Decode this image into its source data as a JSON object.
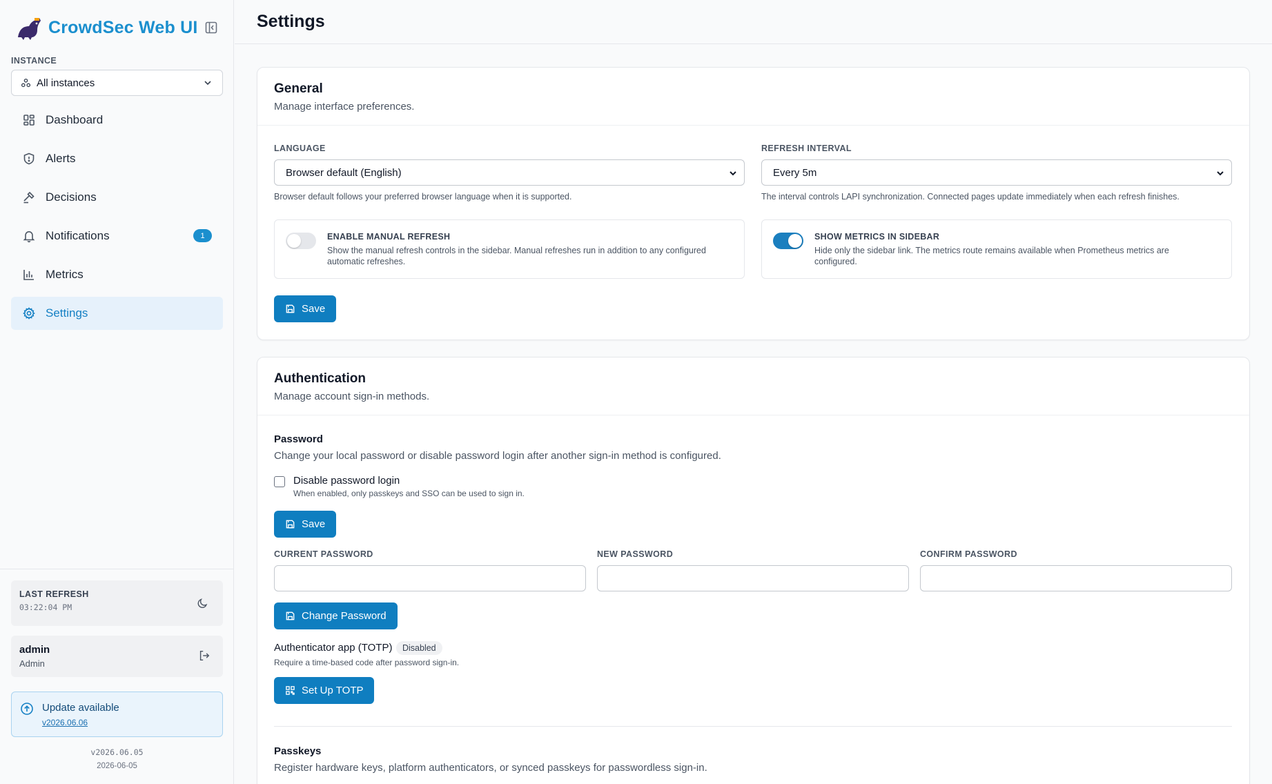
{
  "brand": {
    "title": "CrowdSec Web UI"
  },
  "instance": {
    "label": "INSTANCE",
    "selected": "All instances"
  },
  "nav": {
    "items": [
      {
        "label": "Dashboard"
      },
      {
        "label": "Alerts"
      },
      {
        "label": "Decisions"
      },
      {
        "label": "Notifications",
        "badge": "1"
      },
      {
        "label": "Metrics"
      },
      {
        "label": "Settings",
        "active": true
      }
    ]
  },
  "sidebar_footer": {
    "last_refresh_label": "LAST REFRESH",
    "last_refresh_time": "03:22:04 PM",
    "user_name": "admin",
    "user_role": "Admin",
    "update_title": "Update available",
    "update_version": "v2026.06.06",
    "current_version": "v2026.06.05",
    "build_date": "2026-06-05"
  },
  "page": {
    "title": "Settings"
  },
  "general": {
    "title": "General",
    "subtitle": "Manage interface preferences.",
    "language_label": "LANGUAGE",
    "language_value": "Browser default (English)",
    "language_help": "Browser default follows your preferred browser language when it is supported.",
    "interval_label": "REFRESH INTERVAL",
    "interval_value": "Every 5m",
    "interval_help": "The interval controls LAPI synchronization. Connected pages update immediately when each refresh finishes.",
    "manual_refresh_title": "ENABLE MANUAL REFRESH",
    "manual_refresh_desc": "Show the manual refresh controls in the sidebar. Manual refreshes run in addition to any configured automatic refreshes.",
    "manual_refresh_enabled": false,
    "metrics_title": "SHOW METRICS IN SIDEBAR",
    "metrics_desc": "Hide only the sidebar link. The metrics route remains available when Prometheus metrics are configured.",
    "metrics_enabled": true,
    "save_label": "Save"
  },
  "auth": {
    "title": "Authentication",
    "subtitle": "Manage account sign-in methods.",
    "password_title": "Password",
    "password_desc": "Change your local password or disable password login after another sign-in method is configured.",
    "disable_label": "Disable password login",
    "disable_help": "When enabled, only passkeys and SSO can be used to sign in.",
    "save_label": "Save",
    "current_label": "CURRENT PASSWORD",
    "new_label": "NEW PASSWORD",
    "confirm_label": "CONFIRM PASSWORD",
    "change_label": "Change Password",
    "totp_title": "Authenticator app (TOTP)",
    "totp_status": "Disabled",
    "totp_desc": "Require a time-based code after password sign-in.",
    "totp_button": "Set Up TOTP",
    "passkeys_title": "Passkeys",
    "passkeys_desc": "Register hardware keys, platform authenticators, or synced passkeys for passwordless sign-in."
  },
  "colors": {
    "accent": "#0f7ec0",
    "brand": "#1b8fce",
    "active_bg": "#e6f1fb"
  }
}
